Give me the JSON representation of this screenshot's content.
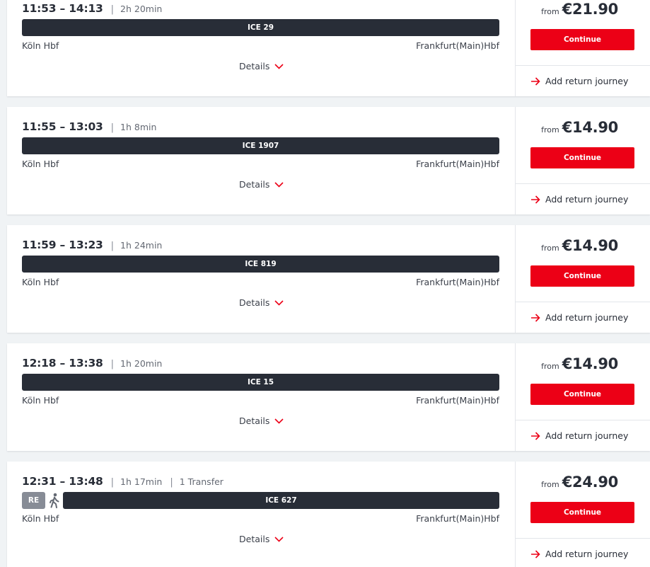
{
  "labels": {
    "from": "from",
    "continue": "Continue",
    "details": "Details",
    "add_return": "Add return journey"
  },
  "colors": {
    "accent_red": "#ec0016",
    "train_bar": "#282d37",
    "regional_badge": "#878c96",
    "background": "#f0f3f5"
  },
  "connections": [
    {
      "time": "11:53 – 14:13",
      "duration": "2h 20min",
      "transfers": "",
      "segments": [
        {
          "kind": "train",
          "label": "ICE 29"
        }
      ],
      "origin": "Köln Hbf",
      "destination": "Frankfurt(Main)Hbf",
      "price": "€21.90"
    },
    {
      "time": "11:55 – 13:03",
      "duration": "1h 8min",
      "transfers": "",
      "segments": [
        {
          "kind": "train",
          "label": "ICE 1907"
        }
      ],
      "origin": "Köln Hbf",
      "destination": "Frankfurt(Main)Hbf",
      "price": "€14.90"
    },
    {
      "time": "11:59 – 13:23",
      "duration": "1h 24min",
      "transfers": "",
      "segments": [
        {
          "kind": "train",
          "label": "ICE 819"
        }
      ],
      "origin": "Köln Hbf",
      "destination": "Frankfurt(Main)Hbf",
      "price": "€14.90"
    },
    {
      "time": "12:18 – 13:38",
      "duration": "1h 20min",
      "transfers": "",
      "segments": [
        {
          "kind": "train",
          "label": "ICE 15"
        }
      ],
      "origin": "Köln Hbf",
      "destination": "Frankfurt(Main)Hbf",
      "price": "€14.90"
    },
    {
      "time": "12:31 – 13:48",
      "duration": "1h 17min",
      "transfers": "1 Transfer",
      "segments": [
        {
          "kind": "badge",
          "label": "RE"
        },
        {
          "kind": "walk",
          "icon": "walking-person-icon"
        },
        {
          "kind": "train",
          "label": "ICE 627"
        }
      ],
      "origin": "Köln Hbf",
      "destination": "Frankfurt(Main)Hbf",
      "price": "€24.90"
    }
  ]
}
